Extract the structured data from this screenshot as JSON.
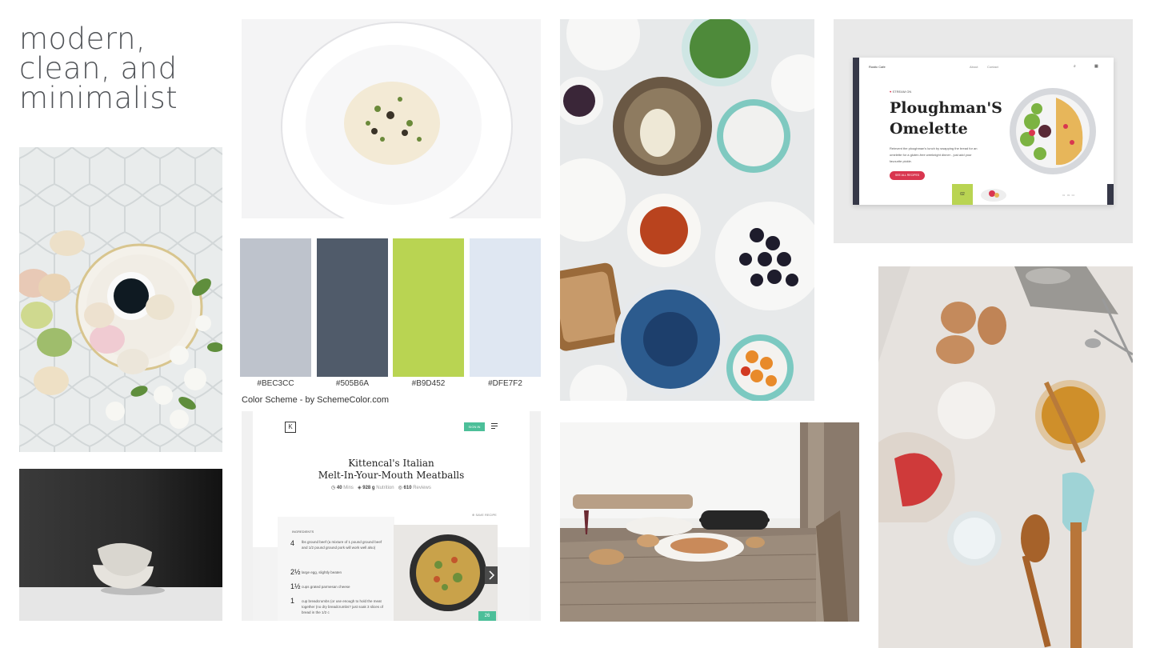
{
  "moodboard": {
    "title_lines": [
      "modern,",
      "clean, and",
      "minimalist"
    ]
  },
  "palette": {
    "swatches": [
      {
        "hex": "#BEC3CC",
        "label": "#BEC3CC"
      },
      {
        "hex": "#505B6A",
        "label": "#505B6A"
      },
      {
        "hex": "#B9D452",
        "label": "#B9D452"
      },
      {
        "hex": "#DFE7F2",
        "label": "#DFE7F2"
      }
    ],
    "credit": "Color Scheme - by SchemeColor.com"
  },
  "recipe_site": {
    "logo": "K",
    "signin": "SIGN IN",
    "title_line1": "Kittencal's Italian",
    "title_line2": "Melt-In-Your-Mouth Meatballs",
    "stat1_value": "40",
    "stat1_unit": "Mins",
    "stat2_value": "928 g",
    "stat2_unit": "Nutrition",
    "stat3_value": "610",
    "stat3_unit": "Reviews",
    "save": "SAVE RECIPE",
    "ingredients_heading": "INGREDIENTS",
    "ingredients": [
      {
        "qty": "4",
        "text": "lbs ground beef (a mixture of 1 pound ground beef and 1/2 pound ground pork will work well also)"
      },
      {
        "qty": "2½",
        "text": "large egg, slightly beaten"
      },
      {
        "qty": "1½",
        "text": "cups grated parmesan cheese"
      },
      {
        "qty": "1",
        "text": "cup breadcrumbs (or use enough to hold the meat together (no dry breadcrumbs? just soak 3 slices of bread in the 1/2 c"
      }
    ],
    "photo_badge": "26"
  },
  "omelette_site": {
    "brand": "Rustic Cafe",
    "nav_about": "About",
    "nav_contact": "Contact",
    "kicker": "STREAM ON",
    "heading_line1": "Ploughman'S",
    "heading_line2": "Omelette",
    "body": "Reinvent the ploughman's lunch by swapping the bread for an omelette for a gluten-free weeknight dinner - just add your favourite pickle.",
    "cta": "SEE ALL RECIPES",
    "slide_number": "02"
  },
  "colors": {
    "title": "#505357",
    "accent_teal": "#4cbf99",
    "accent_red": "#d9364f"
  }
}
